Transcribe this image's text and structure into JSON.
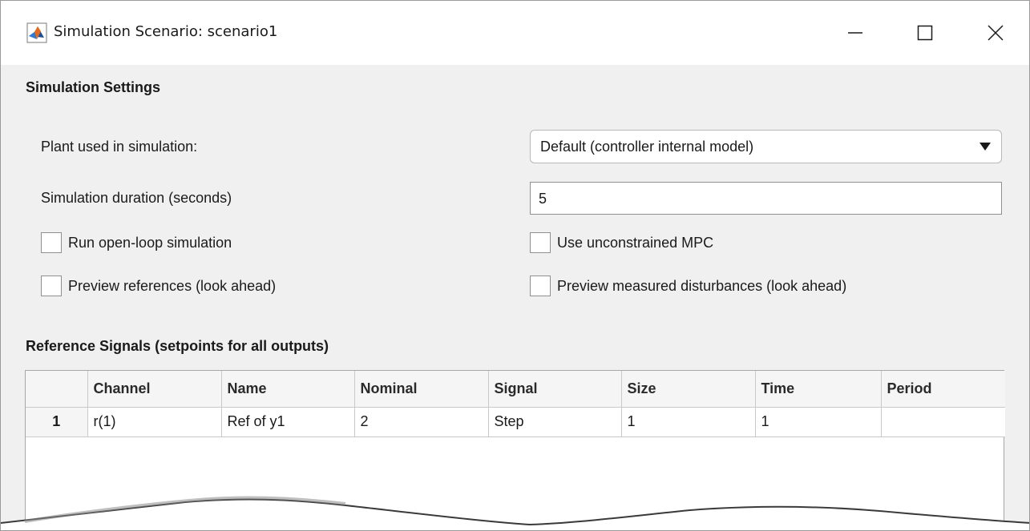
{
  "window": {
    "title": "Simulation Scenario: scenario1",
    "app_icon": "matlab-icon",
    "controls": [
      "minimize-icon",
      "maximize-icon",
      "close-icon"
    ]
  },
  "simulation_settings": {
    "heading": "Simulation Settings",
    "plant_label": "Plant used in simulation:",
    "plant_value": "Default (controller internal model)",
    "duration_label": "Simulation duration (seconds)",
    "duration_value": "5",
    "open_loop": {
      "label": "Run open-loop simulation",
      "checked": false
    },
    "unconstrained": {
      "label": "Use unconstrained MPC",
      "checked": false
    },
    "preview_refs": {
      "label": "Preview references (look ahead)",
      "checked": false
    },
    "preview_md": {
      "label": "Preview measured disturbances (look ahead)",
      "checked": false
    }
  },
  "reference_signals": {
    "heading": "Reference Signals (setpoints for all outputs)",
    "columns": [
      "",
      "Channel",
      "Name",
      "Nominal",
      "Signal",
      "Size",
      "Time",
      "Period"
    ],
    "rows": [
      [
        "1",
        "r(1)",
        "Ref of y1",
        "2",
        "Step",
        "1",
        "1",
        ""
      ]
    ]
  },
  "colors": {
    "window_bg": "#f0f0f0",
    "titlebar_bg": "#ffffff",
    "matlab_orange": "#e16a1f",
    "matlab_blue": "#1f4e99"
  }
}
